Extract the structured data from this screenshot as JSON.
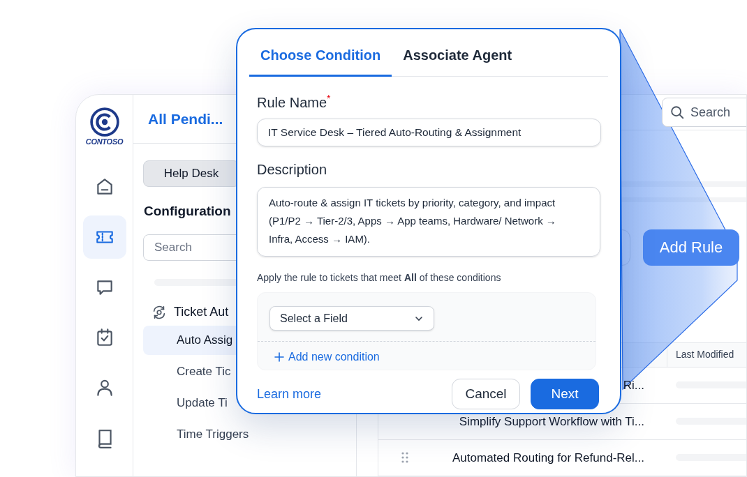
{
  "brand": {
    "name": "CONTOSO"
  },
  "nav_rail": [
    {
      "kind": "home",
      "selected": false
    },
    {
      "kind": "ticket",
      "selected": true
    },
    {
      "kind": "chat",
      "selected": false
    },
    {
      "kind": "calendar",
      "selected": false
    },
    {
      "kind": "user",
      "selected": false
    },
    {
      "kind": "book",
      "selected": false
    }
  ],
  "panel": {
    "title": "All Pendi...",
    "workspace_button": "Help Desk",
    "section_title": "Configuration",
    "search": {
      "placeholder": "Search"
    },
    "groups": [
      {
        "label": "Ticket Aut",
        "children": [
          {
            "label": "Auto Assig",
            "selected": true
          },
          {
            "label": "Create Tic",
            "selected": false
          },
          {
            "label": "Update Ti",
            "selected": false
          },
          {
            "label": "Time Triggers",
            "selected": false
          }
        ]
      }
    ]
  },
  "header": {
    "search": {
      "placeholder": "Search"
    }
  },
  "toolbar": {
    "add_button": "Add Rule"
  },
  "table": {
    "columns": [
      "Last Modified"
    ],
    "rows": [
      {
        "title": "Ri..."
      },
      {
        "title": "Simplify Support Workflow with Ti..."
      },
      {
        "title": "Automated Routing for Refund-Rel...",
        "handle": true
      }
    ]
  },
  "modal": {
    "tabs": [
      {
        "label": "Choose Condition",
        "selected": true
      },
      {
        "label": "Associate Agent",
        "selected": false
      }
    ],
    "rule_name": {
      "label": "Rule Name",
      "required_mark": "*",
      "value": "IT Service Desk – Tiered Auto-Routing & Assignment"
    },
    "description": {
      "label": "Description",
      "value": "Auto-route & assign IT tickets by priority, category, and impact (P1/P2 → Tier-2/3, Apps → App teams, Hardware/ Network → Infra, Access → IAM)."
    },
    "conditions": {
      "hint": "Apply the rule to tickets that meet **All** of these conditions",
      "field_select": {
        "placeholder": "Select a Field"
      },
      "add_link": "Add new condition"
    },
    "learn_more": "Learn more",
    "buttons": [
      {
        "label": "Cancel",
        "kind": "secondary"
      },
      {
        "label": "Next",
        "kind": "primary"
      }
    ]
  }
}
